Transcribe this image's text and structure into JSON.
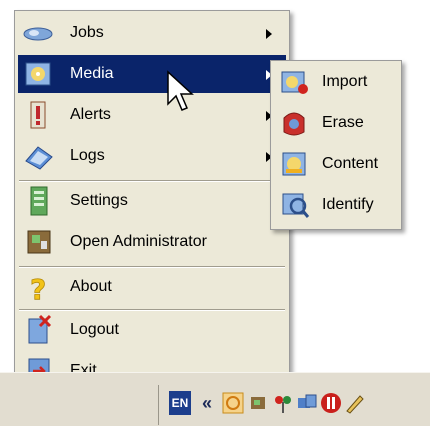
{
  "menu": {
    "items": [
      {
        "label": "Jobs",
        "icon": "jobs-icon",
        "submenu": true
      },
      {
        "label": "Media",
        "icon": "media-icon",
        "submenu": true,
        "selected": true
      },
      {
        "label": "Alerts",
        "icon": "alerts-icon",
        "submenu": true
      },
      {
        "label": "Logs",
        "icon": "logs-icon",
        "submenu": true
      },
      {
        "label": "Settings",
        "icon": "settings-icon",
        "submenu": false
      },
      {
        "label": "Open Administrator",
        "icon": "administrator-icon",
        "submenu": false
      },
      {
        "label": "About",
        "icon": "about-icon",
        "submenu": false
      },
      {
        "label": "Logout",
        "icon": "logout-icon",
        "submenu": false
      },
      {
        "label": "Exit",
        "icon": "exit-icon",
        "submenu": false
      }
    ]
  },
  "submenu": {
    "items": [
      {
        "label": "Import",
        "icon": "import-icon"
      },
      {
        "label": "Erase",
        "icon": "erase-icon"
      },
      {
        "label": "Content",
        "icon": "content-icon"
      },
      {
        "label": "Identify",
        "icon": "identify-icon"
      }
    ]
  },
  "taskbar": {
    "language": "EN",
    "expand": "«",
    "tray_icons": [
      "clock-icon",
      "network-icon",
      "plug-icon",
      "devices-icon",
      "app-red-icon",
      "pen-icon"
    ]
  },
  "colors": {
    "menu_bg": "#ece9d8",
    "selection": "#0a246a",
    "taskbar_bg": "#e2ddd0"
  }
}
